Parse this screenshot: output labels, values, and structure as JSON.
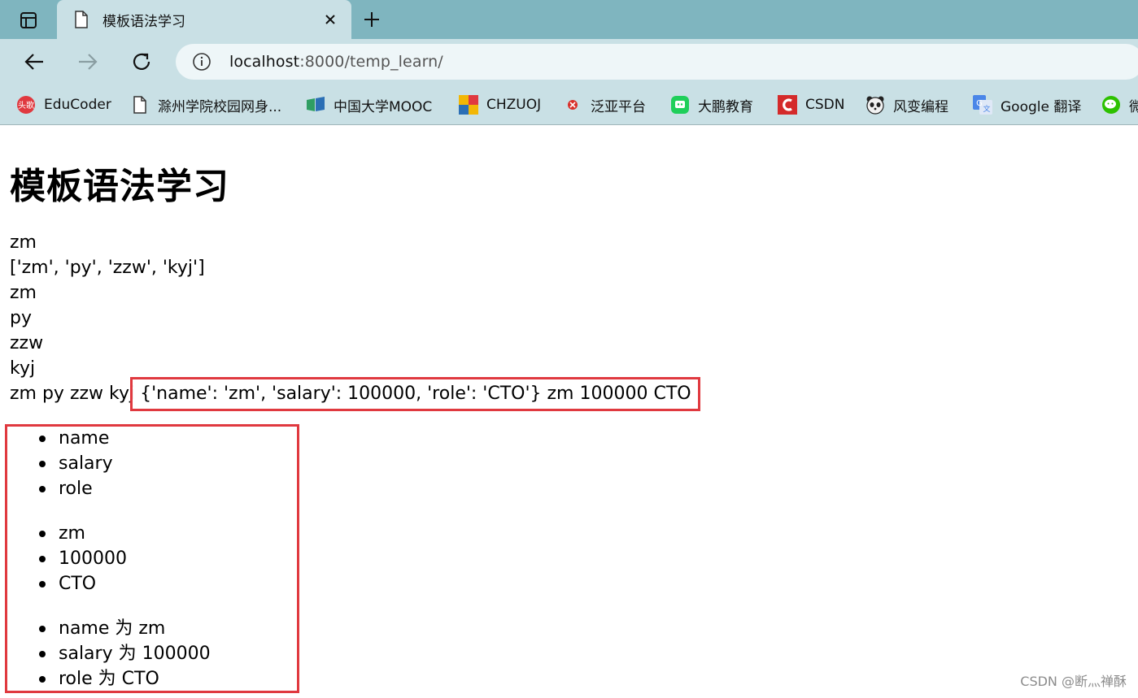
{
  "browser": {
    "tab": {
      "title": "模板语法学习"
    },
    "address_bar": {
      "host": "localhost",
      "path": ":8000/temp_learn/"
    },
    "bookmarks": [
      {
        "label": "EduCoder",
        "icon": "educoder-icon",
        "color": "#e0393f"
      },
      {
        "label": "滁州学院校园网身...",
        "icon": "page-icon",
        "color": "#444444"
      },
      {
        "label": "中国大学MOOC",
        "icon": "mooc-icon",
        "color": "#2f9e63"
      },
      {
        "label": "CHZUOJ",
        "icon": "chzuoj-icon",
        "color": "#f2b705"
      },
      {
        "label": "泛亚平台",
        "icon": "fanya-icon",
        "color": "#d9302a"
      },
      {
        "label": "大鹏教育",
        "icon": "dapeng-icon",
        "color": "#1fcf5a"
      },
      {
        "label": "CSDN",
        "icon": "csdn-icon",
        "color": "#d42a2a"
      },
      {
        "label": "风变编程",
        "icon": "panda-icon",
        "color": "#333333"
      },
      {
        "label": "Google 翻译",
        "icon": "google-translate-icon",
        "color": "#4a86e8"
      },
      {
        "label": "微",
        "icon": "wechat-icon",
        "color": "#2dc100"
      }
    ]
  },
  "page": {
    "heading": "模板语法学习",
    "lines": [
      "zm",
      "['zm', 'py', 'zzw', 'kyj']",
      "zm",
      "py",
      "zzw",
      "kyj",
      "zm py zzw kyj {'name': 'zm', 'salary': 100000, 'role': 'CTO'} zm 100000 CTO"
    ],
    "keys_list": [
      "name",
      "salary",
      "role"
    ],
    "values_list": [
      "zm",
      "100000",
      "CTO"
    ],
    "items_list": [
      "name 为 zm",
      "salary 为 100000",
      "role 为 CTO"
    ]
  },
  "watermark": "CSDN @断灬禅酥",
  "colors": {
    "highlight": "#e0393f",
    "chrome": "#c9e0e5",
    "tabstrip": "#7fb5bf"
  }
}
